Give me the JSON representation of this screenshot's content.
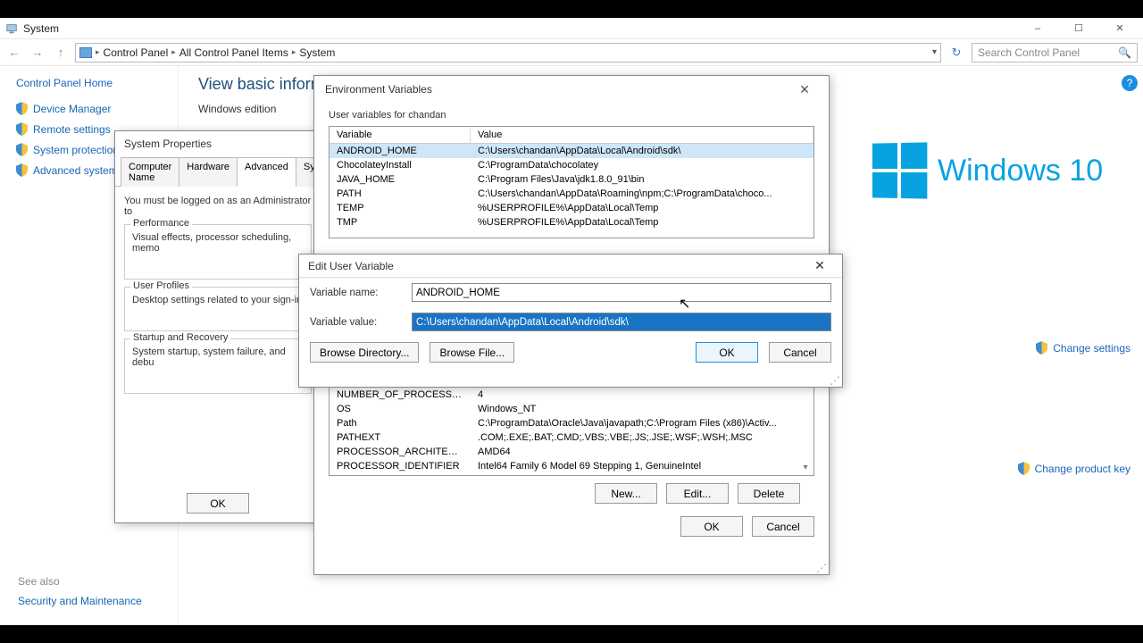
{
  "window": {
    "title": "System",
    "min": "–",
    "max": "☐",
    "close": "✕"
  },
  "nav": {
    "back": "←",
    "forward": "→",
    "up": "↑",
    "refresh": "↻",
    "crumbs": [
      "Control Panel",
      "All Control Panel Items",
      "System"
    ],
    "search_placeholder": "Search Control Panel"
  },
  "help_icon": "?",
  "sidebar": {
    "home": "Control Panel Home",
    "items": [
      "Device Manager",
      "Remote settings",
      "System protection",
      "Advanced system se"
    ]
  },
  "content": {
    "heading": "View basic informatio",
    "edition_label": "Windows edition"
  },
  "right": {
    "brand": "Windows 10",
    "change_settings": "Change settings",
    "change_key": "Change product key"
  },
  "seealso": {
    "title": "See also",
    "link": "Security and Maintenance"
  },
  "sysprops": {
    "title": "System Properties",
    "tabs": [
      "Computer Name",
      "Hardware",
      "Advanced",
      "Sy"
    ],
    "admin_msg": "You must be logged on as an Administrator to",
    "perf": {
      "legend": "Performance",
      "text": "Visual effects, processor scheduling, memo"
    },
    "profiles": {
      "legend": "User Profiles",
      "text": "Desktop settings related to your sign-in"
    },
    "startup": {
      "legend": "Startup and Recovery",
      "text": "System startup, system failure, and debu"
    },
    "ok": "OK"
  },
  "envvars": {
    "title": "Environment Variables",
    "close": "✕",
    "user_group": "User variables for chandan",
    "headers": {
      "var": "Variable",
      "val": "Value"
    },
    "user_vars": [
      {
        "name": "ANDROID_HOME",
        "value": "C:\\Users\\chandan\\AppData\\Local\\Android\\sdk\\"
      },
      {
        "name": "ChocolateyInstall",
        "value": "C:\\ProgramData\\chocolatey"
      },
      {
        "name": "JAVA_HOME",
        "value": "C:\\Program Files\\Java\\jdk1.8.0_91\\bin"
      },
      {
        "name": "PATH",
        "value": "C:\\Users\\chandan\\AppData\\Roaming\\npm;C:\\ProgramData\\choco..."
      },
      {
        "name": "TEMP",
        "value": "%USERPROFILE%\\AppData\\Local\\Temp"
      },
      {
        "name": "TMP",
        "value": "%USERPROFILE%\\AppData\\Local\\Temp"
      }
    ],
    "sys_vars": [
      {
        "name": "NUMBER_OF_PROCESSORS",
        "value": "4"
      },
      {
        "name": "OS",
        "value": "Windows_NT"
      },
      {
        "name": "Path",
        "value": "C:\\ProgramData\\Oracle\\Java\\javapath;C:\\Program Files (x86)\\Activ..."
      },
      {
        "name": "PATHEXT",
        "value": ".COM;.EXE;.BAT;.CMD;.VBS;.VBE;.JS;.JSE;.WSF;.WSH;.MSC"
      },
      {
        "name": "PROCESSOR_ARCHITECTURE",
        "value": "AMD64"
      },
      {
        "name": "PROCESSOR_IDENTIFIER",
        "value": "Intel64 Family 6 Model 69 Stepping 1, GenuineIntel"
      }
    ],
    "buttons": {
      "new": "New...",
      "edit": "Edit...",
      "delete": "Delete",
      "ok": "OK",
      "cancel": "Cancel"
    }
  },
  "editvar": {
    "title": "Edit User Variable",
    "close": "✕",
    "name_label": "Variable name:",
    "name_value": "ANDROID_HOME",
    "value_label": "Variable value:",
    "value_value": "C:\\Users\\chandan\\AppData\\Local\\Android\\sdk\\",
    "browse_dir": "Browse Directory...",
    "browse_file": "Browse File...",
    "ok": "OK",
    "cancel": "Cancel"
  }
}
